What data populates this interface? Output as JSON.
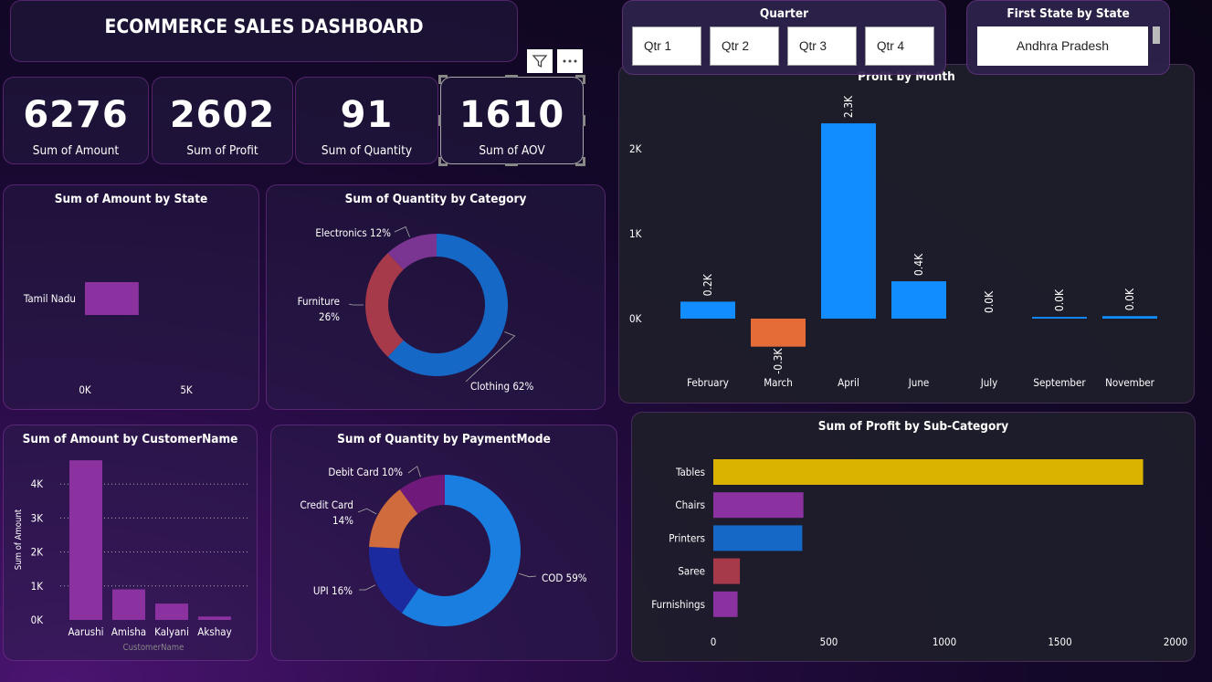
{
  "header": {
    "title": "ECOMMERCE SALES DASHBOARD"
  },
  "kpis": [
    {
      "value": "6276",
      "label": "Sum of Amount"
    },
    {
      "value": "2602",
      "label": "Sum of Profit"
    },
    {
      "value": "91",
      "label": "Sum of Quantity"
    },
    {
      "value": "1610",
      "label": "Sum of AOV"
    }
  ],
  "quarter_slicer": {
    "title": "Quarter",
    "options": [
      "Qtr 1",
      "Qtr 2",
      "Qtr 3",
      "Qtr 4"
    ]
  },
  "state_slicer": {
    "title": "First State by State",
    "value": "Andhra Pradesh"
  },
  "toolbar": {
    "filter_icon": "filter-icon",
    "more_icon": "more-options-icon"
  },
  "colors": {
    "blue": "#118dff",
    "orange": "#e66c37",
    "purple": "#8b31a0",
    "yellow": "#d9b300",
    "red": "#a73a4a",
    "darkblue": "#12239e",
    "midblue": "#1568c6"
  },
  "charts": {
    "amount_by_state": {
      "title": "Sum of Amount by State",
      "chart_data": {
        "type": "bar",
        "orientation": "horizontal",
        "categories": [
          "Tamil Nadu"
        ],
        "values": [
          2650
        ],
        "xticks": [
          "0K",
          "5K"
        ],
        "xlim": [
          0,
          6000
        ]
      }
    },
    "quantity_by_category": {
      "title": "Sum of Quantity by Category",
      "chart_data": {
        "type": "pie",
        "donut": true,
        "labels": [
          "Clothing",
          "Furniture",
          "Electronics"
        ],
        "values": [
          62,
          26,
          12
        ],
        "label_text": [
          "Clothing 62%",
          "Furniture",
          "Electronics 12%"
        ],
        "label_pct": [
          "",
          "26%",
          ""
        ]
      }
    },
    "amount_by_customer": {
      "title": "Sum of Amount by CustomerName",
      "chart_data": {
        "type": "bar",
        "categories": [
          "Aarushi",
          "Amisha",
          "Kalyani",
          "Akshay"
        ],
        "values": [
          4700,
          900,
          480,
          100
        ],
        "yticks": [
          "0K",
          "1K",
          "2K",
          "3K",
          "4K"
        ],
        "ylim": [
          0,
          4700
        ],
        "xlabel": "CustomerName",
        "ylabel": "Sum of Amount"
      }
    },
    "quantity_by_payment": {
      "title": "Sum of Quantity by PaymentMode",
      "chart_data": {
        "type": "pie",
        "donut": true,
        "labels": [
          "COD",
          "UPI",
          "Credit Card",
          "Debit Card"
        ],
        "values": [
          59,
          16,
          14,
          10
        ],
        "label_text": [
          "COD 59%",
          "UPI 16%",
          "Credit Card",
          "Debit Card 10%"
        ],
        "label_pct": [
          "",
          "",
          "14%",
          ""
        ]
      }
    },
    "profit_by_month": {
      "title": "Profit by Month",
      "chart_data": {
        "type": "bar",
        "categories": [
          "February",
          "March",
          "April",
          "June",
          "July",
          "September",
          "November"
        ],
        "values": [
          200,
          -330,
          2300,
          440,
          0,
          20,
          30
        ],
        "data_labels": [
          "0.2K",
          "-0.3K",
          "2.3K",
          "0.4K",
          "0.0K",
          "0.0K",
          "0.0K"
        ],
        "yticks": [
          "0K",
          "1K",
          "2K"
        ],
        "ylim": [
          -330,
          2300
        ]
      }
    },
    "profit_by_subcategory": {
      "title": "Sum of Profit by Sub-Category",
      "chart_data": {
        "type": "bar",
        "orientation": "horizontal",
        "categories": [
          "Tables",
          "Chairs",
          "Printers",
          "Saree",
          "Furnishings"
        ],
        "values": [
          1860,
          390,
          385,
          115,
          105
        ],
        "xticks": [
          "0",
          "500",
          "1000",
          "1500",
          "2000"
        ],
        "xlim": [
          0,
          2000
        ]
      }
    }
  }
}
